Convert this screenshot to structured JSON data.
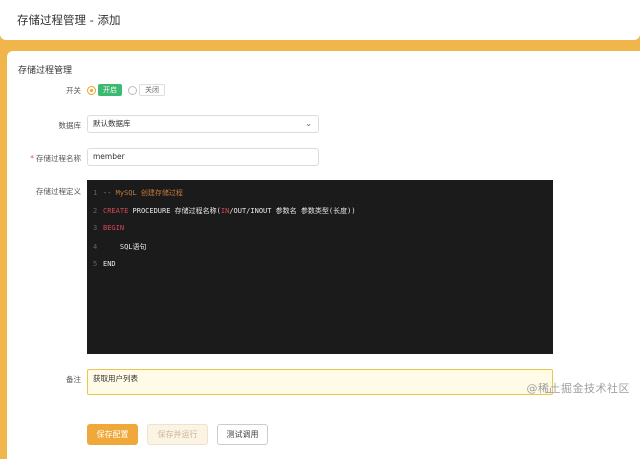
{
  "header": {
    "title": "存储过程管理 - 添加"
  },
  "section": {
    "title": "存储过程管理"
  },
  "form": {
    "switch": {
      "label": "开关",
      "on_label": "开启",
      "off_label": "关闭",
      "selected": "开启"
    },
    "database": {
      "label": "数据库",
      "value": "默认数据库"
    },
    "name": {
      "required_mark": "*",
      "label": "存储过程名称",
      "value": "member"
    },
    "definition": {
      "label": "存储过程定义",
      "lines": [
        {
          "num": "1",
          "parts": [
            {
              "cls": "cmt",
              "text": "-- MySQL 创建存储过程"
            }
          ]
        },
        {
          "num": "2",
          "parts": [
            {
              "cls": "kw",
              "text": "CREATE"
            },
            {
              "cls": "",
              "text": " PROCEDURE 存储过程名称("
            },
            {
              "cls": "kw",
              "text": "IN"
            },
            {
              "cls": "",
              "text": "/OUT/INOUT 参数名 参数类型(长度))"
            }
          ]
        },
        {
          "num": "3",
          "parts": [
            {
              "cls": "kw",
              "text": "BEGIN"
            }
          ]
        },
        {
          "num": "4",
          "parts": [
            {
              "cls": "",
              "text": "    SQL语句"
            }
          ]
        },
        {
          "num": "5",
          "parts": [
            {
              "cls": "",
              "text": "END"
            }
          ]
        }
      ]
    },
    "remark": {
      "label": "备注",
      "value": "获取用户列表"
    }
  },
  "buttons": {
    "save": "保存配置",
    "save_run": "保存并运行",
    "test": "测试调用"
  },
  "watermark": "@稀土掘金技术社区",
  "colors": {
    "background": "#f0b64b",
    "primary": "#f0a83a",
    "switch_on": "#3dba71",
    "editor_bg": "#1b1b1b"
  }
}
